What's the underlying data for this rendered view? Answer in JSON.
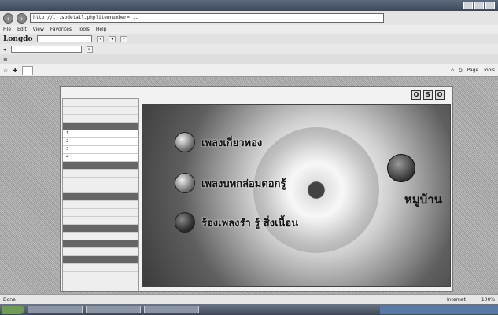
{
  "browser": {
    "address": "http://...sodetail.php?itemnumber=...",
    "menu": [
      "File",
      "Edit",
      "View",
      "Favorites",
      "Tools",
      "Help"
    ],
    "brand": "Longdo",
    "tabs": [
      ""
    ],
    "commands": [
      "Page",
      "Tools"
    ]
  },
  "page": {
    "top_icons": [
      "Q",
      "S",
      "O"
    ],
    "sidebar": [
      {
        "label": "",
        "type": "item"
      },
      {
        "label": "",
        "type": "item"
      },
      {
        "label": "",
        "type": "item"
      },
      {
        "label": "",
        "type": "heading"
      },
      {
        "label": "1",
        "type": "numbered"
      },
      {
        "label": "2",
        "type": "numbered"
      },
      {
        "label": "3",
        "type": "numbered"
      },
      {
        "label": "4",
        "type": "numbered"
      },
      {
        "label": "",
        "type": "heading"
      },
      {
        "label": "",
        "type": "item"
      },
      {
        "label": "",
        "type": "item"
      },
      {
        "label": "",
        "type": "item"
      },
      {
        "label": "",
        "type": "heading"
      },
      {
        "label": "",
        "type": "item"
      },
      {
        "label": "",
        "type": "item"
      },
      {
        "label": "",
        "type": "item"
      },
      {
        "label": "",
        "type": "heading"
      },
      {
        "label": "",
        "type": "item"
      },
      {
        "label": "",
        "type": "heading"
      },
      {
        "label": "",
        "type": "item"
      },
      {
        "label": "",
        "type": "heading"
      },
      {
        "label": "",
        "type": "item"
      }
    ],
    "menu_buttons": [
      {
        "label": "เพลงเกี่ยวทอง"
      },
      {
        "label": "เพลงบทกล่อมดอกรู้"
      },
      {
        "label": "ร้องเพลงรำ รู้ สิ่งเนื้อน"
      }
    ],
    "home_label": "หมูบ้าน"
  },
  "status": {
    "left": "Done",
    "zone": "Internet",
    "zoom": "100%"
  }
}
